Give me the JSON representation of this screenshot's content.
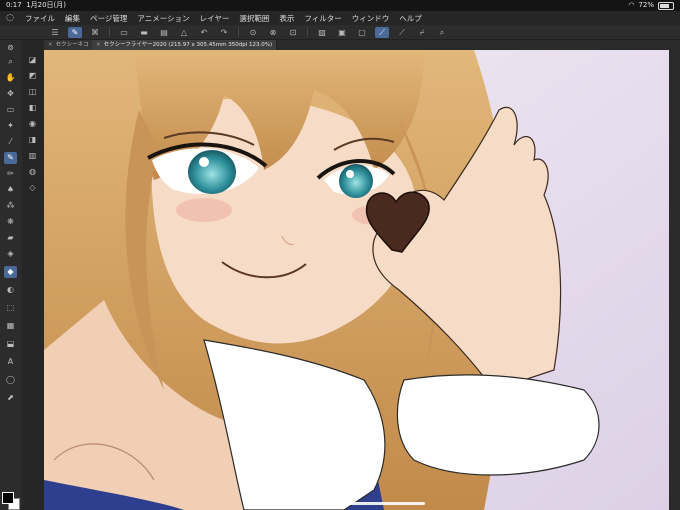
{
  "status": {
    "time": "0:17",
    "date": "1月20日(月)",
    "battery_percent": "72%",
    "battery_level": 0.72,
    "wifi_icon": "wifi-icon",
    "battery_icon": "battery-icon"
  },
  "menu": [
    "ファイル",
    "編集",
    "ページ管理",
    "アニメーション",
    "レイヤー",
    "選択範囲",
    "表示",
    "フィルター",
    "ウィンドウ",
    "ヘルプ"
  ],
  "tabs": [
    {
      "label": "セクシーネコ"
    },
    {
      "label": "セクシーフライヤー2020 (215.97 x 305.45mm 350dpi 123.0%)"
    }
  ],
  "colors": {
    "canvas_bg": "#e8dfee",
    "main_color": "#000000",
    "sub_color": "#ffffff",
    "accent": "#4a6a9a"
  }
}
